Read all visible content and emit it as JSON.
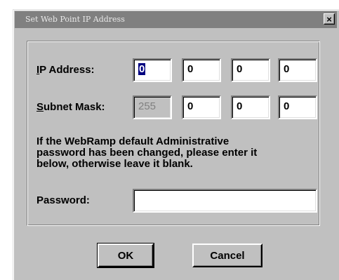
{
  "window": {
    "title": "Set Web Point IP Address",
    "close_glyph": "×"
  },
  "ip": {
    "label_prefix": "",
    "label_hotkey": "I",
    "label_rest": "P Address:",
    "octets": [
      "0",
      "0",
      "0",
      "0"
    ]
  },
  "mask": {
    "label_hotkey": "S",
    "label_rest": "ubnet Mask:",
    "octets": [
      "255",
      "0",
      "0",
      "0"
    ]
  },
  "info": {
    "lines": [
      "If the WebRamp default Administrative",
      "password has been changed, please enter it",
      "below, otherwise leave it blank."
    ]
  },
  "password": {
    "label": "Password:",
    "value": ""
  },
  "buttons": {
    "ok": "OK",
    "cancel": "Cancel"
  },
  "colors": {
    "dialog_face": "#c0c0c0",
    "titlebar": "#808080",
    "selection": "#000080"
  }
}
